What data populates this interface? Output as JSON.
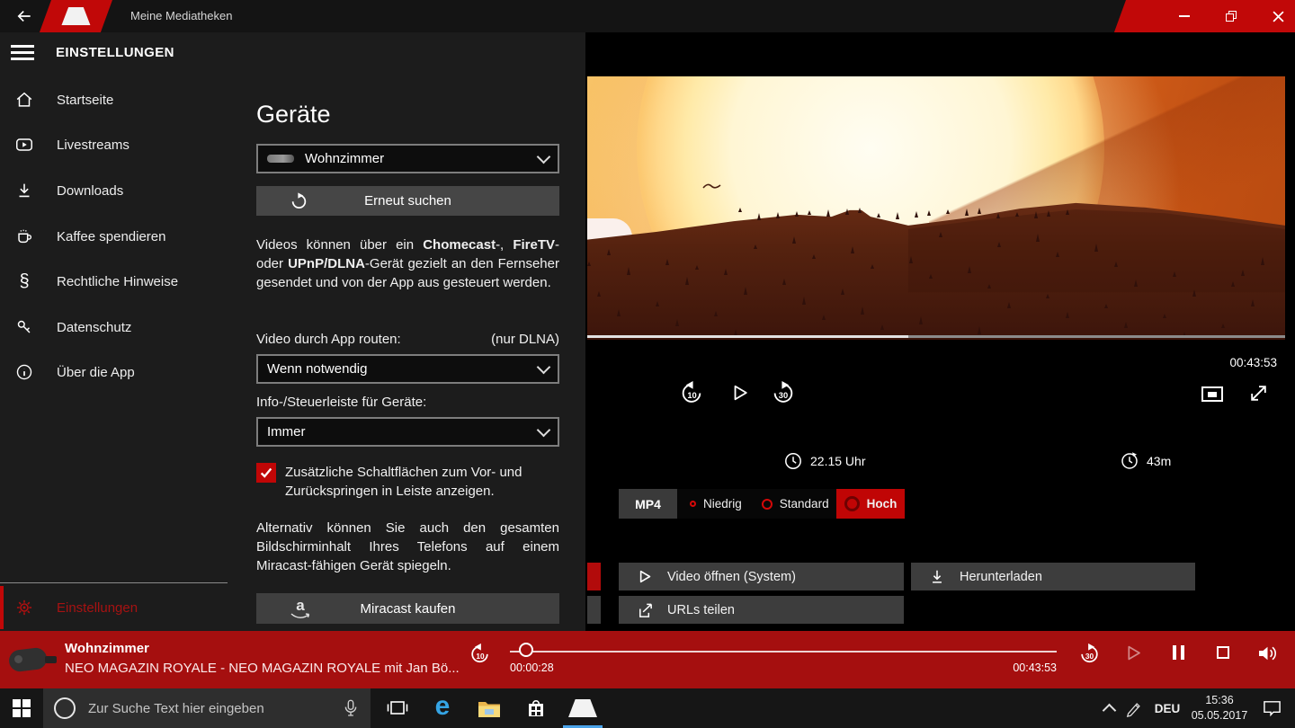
{
  "colors": {
    "accent_red": "#c10808",
    "player_bar_red": "#a50f0f",
    "selected_quality_red": "#c00505",
    "checkbox_red": "#c00606",
    "taskbar_indicator_blue": "#4aa3e8"
  },
  "titlebar": {
    "title": "Meine Mediatheken"
  },
  "sidebar": {
    "header": "EINSTELLUNGEN",
    "items": [
      {
        "label": "Startseite",
        "icon": "home-icon"
      },
      {
        "label": "Livestreams",
        "icon": "livestream-icon"
      },
      {
        "label": "Downloads",
        "icon": "download-icon"
      },
      {
        "label": "Kaffee spendieren",
        "icon": "coffee-icon"
      },
      {
        "label": "Rechtliche Hinweise",
        "icon": "section-sign-icon"
      },
      {
        "label": "Datenschutz",
        "icon": "key-icon"
      },
      {
        "label": "Über die App",
        "icon": "info-icon"
      }
    ],
    "settings": {
      "label": "Einstellungen",
      "icon": "gear-icon"
    }
  },
  "settings_panel": {
    "heading": "Geräte",
    "device_select": {
      "value": "Wohnzimmer"
    },
    "rescan_button": "Erneut suchen",
    "info_segments": [
      {
        "text": "Videos können über ein ",
        "bold": false
      },
      {
        "text": "Chomecast",
        "bold": true
      },
      {
        "text": "-, ",
        "bold": false
      },
      {
        "text": "FireTV",
        "bold": true
      },
      {
        "text": "- oder ",
        "bold": false
      },
      {
        "text": "UPnP/DLNA",
        "bold": true
      },
      {
        "text": "-Gerät gezielt an den Fernseher gesendet und von der App aus gesteuert werden.",
        "bold": false
      }
    ],
    "route_label": "Video durch App routen:",
    "route_note": "(nur DLNA)",
    "route_select": {
      "value": "Wenn notwendig"
    },
    "infobar_label": "Info-/Steuerleiste für Geräte:",
    "infobar_select": {
      "value": "Immer"
    },
    "checkbox": {
      "label": "Zusätzliche Schaltflächen zum Vor- und Zurückspringen in Leiste anzeigen.",
      "checked": true
    },
    "miracast_text": "Alternativ können Sie auch den gesamten Bildschirminhalt Ihres Telefons auf einem Miracast-fähigen Gerät spiegeln.",
    "miracast_button": "Miracast kaufen"
  },
  "video_panel": {
    "duration": "00:43:53",
    "skip_back_label": "10",
    "skip_forward_label": "30",
    "airtime": "22.15 Uhr",
    "remaining": "43m",
    "quality": {
      "format": "MP4",
      "options": [
        {
          "label": "Niedrig",
          "selected": false
        },
        {
          "label": "Standard",
          "selected": false
        },
        {
          "label": "Hoch",
          "selected": true
        }
      ]
    },
    "open_button": "Video öffnen (System)",
    "download_button": "Herunterladen",
    "share_button": "URLs teilen"
  },
  "player_bar": {
    "device_name": "Wohnzimmer",
    "track_title": "NEO MAGAZIN ROYALE - NEO MAGAZIN ROYALE mit Jan Bö...",
    "elapsed": "00:00:28",
    "total": "00:43:53",
    "skip_back_label": "10",
    "skip_forward_label": "30",
    "progress_percent": 3
  },
  "taskbar": {
    "search_placeholder": "Zur Suche Text hier eingeben",
    "language": "DEU",
    "time": "15:36",
    "date": "05.05.2017"
  }
}
